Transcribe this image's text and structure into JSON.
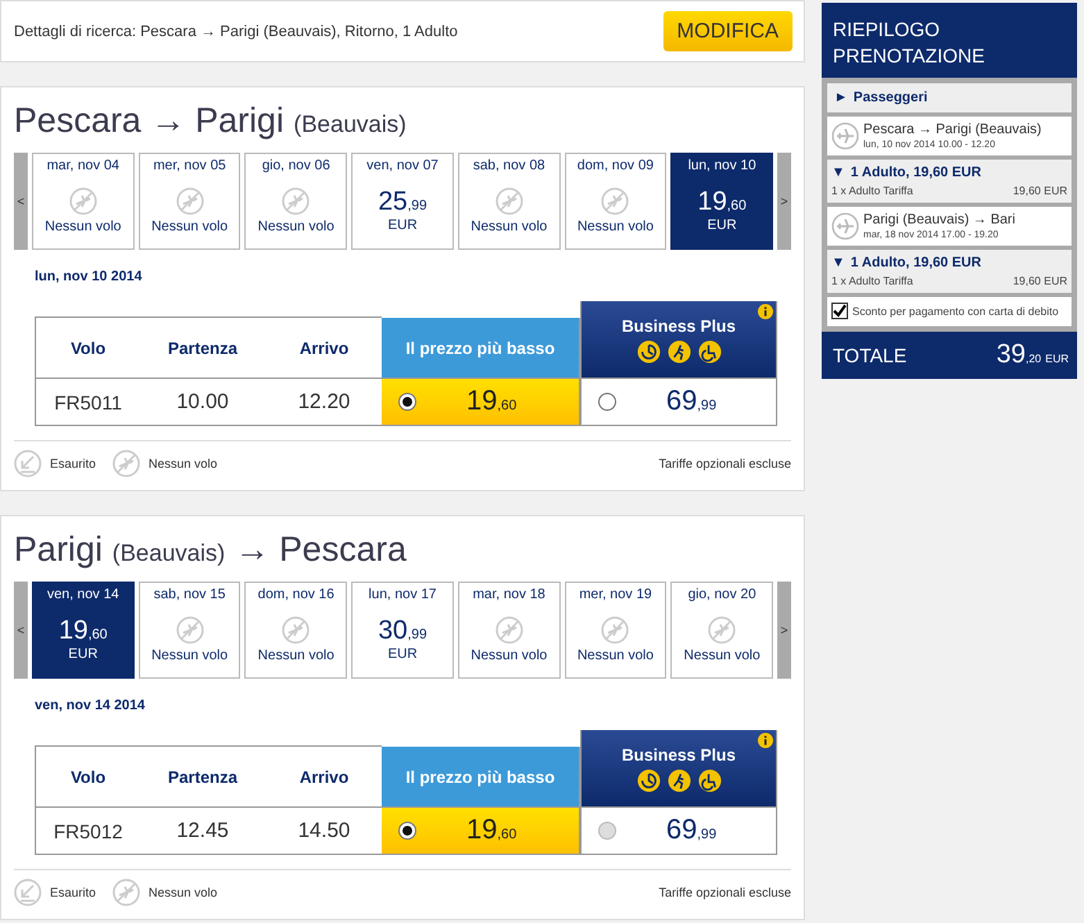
{
  "search": {
    "text": "Dettagli di ricerca: Pescara → Parigi (Beauvais), Ritorno, 1 Adulto",
    "button": "MODIFICA"
  },
  "flights": [
    {
      "title_parts": [
        {
          "text": "Pescara → Parigi",
          "small": false
        },
        {
          "text": "(Beauvais)",
          "small": true
        }
      ],
      "prev": "<",
      "next": ">",
      "days": [
        {
          "label": "mar, nov 04",
          "kind": "none",
          "note": "Nessun volo",
          "selected": false
        },
        {
          "label": "mer, nov 05",
          "kind": "none",
          "note": "Nessun volo",
          "selected": false
        },
        {
          "label": "gio, nov 06",
          "kind": "none",
          "note": "Nessun volo",
          "selected": false
        },
        {
          "label": "ven, nov 07",
          "kind": "price",
          "main": "25",
          "decimal": ",99",
          "currency": "EUR",
          "selected": false
        },
        {
          "label": "sab, nov 08",
          "kind": "none",
          "note": "Nessun volo",
          "selected": false
        },
        {
          "label": "dom, nov 09",
          "kind": "none",
          "note": "Nessun volo",
          "selected": false
        },
        {
          "label": "lun, nov 10",
          "kind": "price",
          "main": "19",
          "decimal": ",60",
          "currency": "EUR",
          "selected": true
        }
      ],
      "date": "lun, nov 10 2014",
      "columns": [
        "Volo",
        "Partenza",
        "Arrivo"
      ],
      "fare_headers": [
        {
          "kind": "lowest",
          "label": "Il prezzo più basso"
        },
        {
          "kind": "business",
          "label": "Business Plus"
        }
      ],
      "rows": [
        {
          "flight": "FR5011",
          "departure": "10.00",
          "arrival": "12.20",
          "fares": [
            {
              "kind": "lowest",
              "main": "19",
              "decimal": ",60",
              "selected": true,
              "disabled": false
            },
            {
              "kind": "business",
              "main": "69",
              "decimal": ",99",
              "selected": false,
              "disabled": false
            }
          ]
        }
      ],
      "legend": [
        {
          "kind": "soldout",
          "label": "Esaurito"
        },
        {
          "kind": "none",
          "label": "Nessun volo"
        }
      ],
      "note": "Tariffe opzionali escluse"
    },
    {
      "title_parts": [
        {
          "text": "Parigi",
          "small": false
        },
        {
          "text": "(Beauvais)",
          "small": true
        },
        {
          "text": "→ Pescara",
          "small": false
        }
      ],
      "prev": "<",
      "next": ">",
      "days": [
        {
          "label": "ven, nov 14",
          "kind": "price",
          "main": "19",
          "decimal": ",60",
          "currency": "EUR",
          "selected": true
        },
        {
          "label": "sab, nov 15",
          "kind": "none",
          "note": "Nessun volo",
          "selected": false
        },
        {
          "label": "dom, nov 16",
          "kind": "none",
          "note": "Nessun volo",
          "selected": false
        },
        {
          "label": "lun, nov 17",
          "kind": "price",
          "main": "30",
          "decimal": ",99",
          "currency": "EUR",
          "selected": false
        },
        {
          "label": "mar, nov 18",
          "kind": "none",
          "note": "Nessun volo",
          "selected": false
        },
        {
          "label": "mer, nov 19",
          "kind": "none",
          "note": "Nessun volo",
          "selected": false
        },
        {
          "label": "gio, nov 20",
          "kind": "none",
          "note": "Nessun volo",
          "selected": false
        }
      ],
      "date": "ven, nov 14 2014",
      "columns": [
        "Volo",
        "Partenza",
        "Arrivo"
      ],
      "fare_headers": [
        {
          "kind": "lowest",
          "label": "Il prezzo più basso"
        },
        {
          "kind": "business",
          "label": "Business Plus"
        }
      ],
      "rows": [
        {
          "flight": "FR5012",
          "departure": "12.45",
          "arrival": "14.50",
          "fares": [
            {
              "kind": "lowest",
              "main": "19",
              "decimal": ",60",
              "selected": true,
              "disabled": false
            },
            {
              "kind": "business",
              "main": "69",
              "decimal": ",99",
              "selected": false,
              "disabled": true
            }
          ]
        }
      ],
      "legend": [
        {
          "kind": "soldout",
          "label": "Esaurito"
        },
        {
          "kind": "none",
          "label": "Nessun volo"
        }
      ],
      "note": "Tariffe opzionali escluse"
    }
  ],
  "summary": {
    "title": "RIEPILOGO PRENOTAZIONE",
    "passengers": {
      "toggle": "►",
      "label": "Passeggeri",
      "expanded": false
    },
    "legs": [
      {
        "route": "Pescara → Parigi (Beauvais)",
        "time": "lun, 10 nov 2014 10.00 - 12.20",
        "toggle": "▼",
        "fare": "1 Adulto, 19,60 EUR",
        "line": "1 x Adulto Tariffa",
        "amount": "19,60 EUR"
      },
      {
        "route": "Parigi (Beauvais) → Bari",
        "time": "mar, 18 nov 2014 17.00 - 19.20",
        "toggle": "▼",
        "fare": "1 Adulto, 19,60 EUR",
        "line": "1 x Adulto Tariffa",
        "amount": "19,60 EUR"
      }
    ],
    "discount": {
      "label": "Sconto per pagamento con carta di debito",
      "checked": true
    },
    "total": {
      "label": "TOTALE",
      "main": "39",
      "decimal": ",20",
      "currency": "EUR"
    }
  }
}
